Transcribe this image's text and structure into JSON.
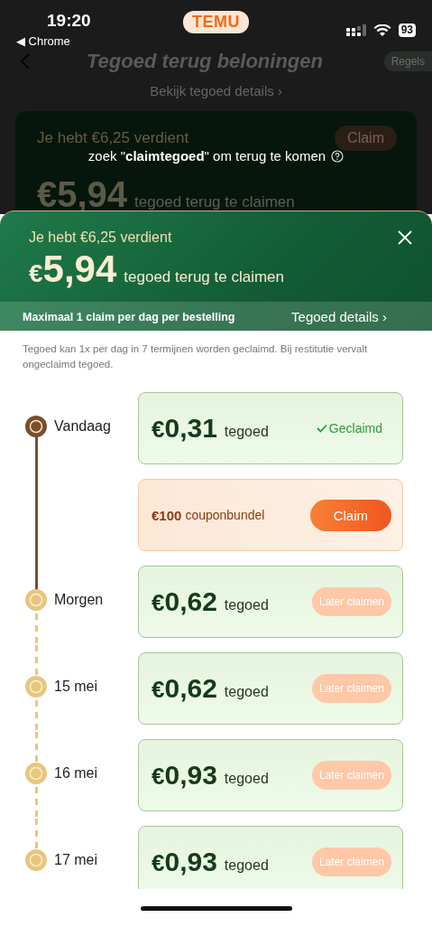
{
  "status_bar": {
    "time": "19:20",
    "back_app": "◀ Chrome",
    "app_badge": "TEMU",
    "battery": "93"
  },
  "page": {
    "title": "Tegoed terug beloningen",
    "rules": "Regels",
    "details_link": "Bekijk tegoed details ›",
    "card": {
      "earned": "Je hebt €6,25 verdient",
      "claim": "Claim",
      "amount": "€5,94",
      "caption": "tegoed terug te claimen"
    }
  },
  "hint": {
    "before": "zoek \"**claimtegoed**\" om terug te komen"
  },
  "sheet": {
    "earned": "Je hebt €6,25 verdient",
    "amount": "€5,94",
    "caption": "tegoed terug te claimen",
    "limit": "Maximaal 1 claim per dag per bestelling",
    "details_link": "Tegoed details ›",
    "note": "Tegoed kan 1x per dag in 7 termijnen worden geclaimd. Bij restitutie vervalt ongeclaimd tegoed.",
    "schedule": [
      {
        "kind": "credit",
        "date": "Vandaag",
        "amount": "€0,31",
        "unit": "tegoed",
        "claimed": true,
        "action": "Geclaimd"
      },
      {
        "kind": "coupon",
        "amount": "€100",
        "unit": "couponbundel",
        "action": "Claim"
      },
      {
        "kind": "credit",
        "date": "Morgen",
        "amount": "€0,62",
        "unit": "tegoed",
        "claimed": false,
        "action": "Later claimen"
      },
      {
        "kind": "credit",
        "date": "15 mei",
        "amount": "€0,62",
        "unit": "tegoed",
        "claimed": false,
        "action": "Later claimen"
      },
      {
        "kind": "credit",
        "date": "16 mei",
        "amount": "€0,93",
        "unit": "tegoed",
        "claimed": false,
        "action": "Later claimen"
      },
      {
        "kind": "credit",
        "date": "17 mei",
        "amount": "€0,93",
        "unit": "tegoed",
        "claimed": false,
        "action": "Later claimen"
      }
    ]
  }
}
